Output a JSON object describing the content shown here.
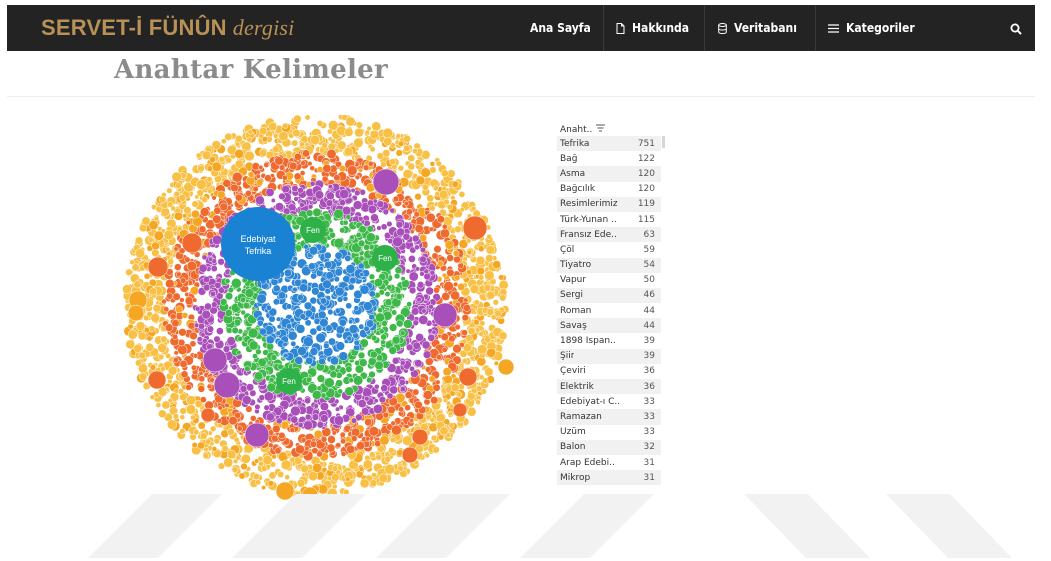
{
  "header": {
    "brand_main": "SERVET-İ FÜNÛN",
    "brand_sub": "dergisi",
    "nav": [
      {
        "label": "Ana Sayfa",
        "icon": "none"
      },
      {
        "label": "Hakkında",
        "icon": "document-icon"
      },
      {
        "label": "Veritabanı",
        "icon": "database-icon"
      },
      {
        "label": "Kategoriler",
        "icon": "menu-icon"
      }
    ],
    "search_icon": "search-icon"
  },
  "page": {
    "title": "Anahtar Kelimeler"
  },
  "bubble_chart": {
    "labels": {
      "edebiyat": "Edebiyat",
      "tefrika": "Tefrika",
      "fen": "Fen"
    },
    "colors": {
      "blue": "#2e86d4",
      "blue_big": "#1a82d2",
      "green": "#3fb84a",
      "purple": "#a94fba",
      "orange_red": "#ef6a2f",
      "orange": "#f5a623",
      "yellow": "#f8c146"
    }
  },
  "table": {
    "header": "Anaht..",
    "rows": [
      {
        "name": "Tefrika",
        "value": "751"
      },
      {
        "name": "Bağ",
        "value": "122"
      },
      {
        "name": "Asma",
        "value": "120"
      },
      {
        "name": "Bağcılık",
        "value": "120"
      },
      {
        "name": "Resimlerimiz",
        "value": "119"
      },
      {
        "name": "Türk-Yunan ..",
        "value": "115"
      },
      {
        "name": "Fransız Ede..",
        "value": "63"
      },
      {
        "name": "Çöl",
        "value": "59"
      },
      {
        "name": "Tiyatro",
        "value": "54"
      },
      {
        "name": "Vapur",
        "value": "50"
      },
      {
        "name": "Sergi",
        "value": "46"
      },
      {
        "name": "Roman",
        "value": "44"
      },
      {
        "name": "Savaş",
        "value": "44"
      },
      {
        "name": "1898 İspan..",
        "value": "39"
      },
      {
        "name": "Şiir",
        "value": "39"
      },
      {
        "name": "Çeviri",
        "value": "36"
      },
      {
        "name": "Elektrik",
        "value": "36"
      },
      {
        "name": "Edebiyat-ı C..",
        "value": "33"
      },
      {
        "name": "Ramazan",
        "value": "33"
      },
      {
        "name": "Üzüm",
        "value": "33"
      },
      {
        "name": "Balon",
        "value": "32"
      },
      {
        "name": "Arap Edebi..",
        "value": "31"
      },
      {
        "name": "Mikrop",
        "value": "31"
      }
    ]
  }
}
